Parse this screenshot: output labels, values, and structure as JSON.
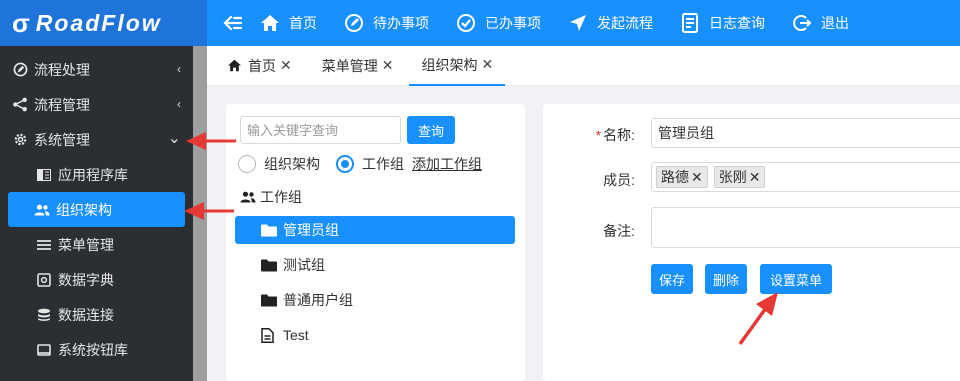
{
  "app": {
    "logo_text": "RoadFlow",
    "logo_mark": "σ"
  },
  "topnav": {
    "toggle_icon": "collapse-arrow-icon",
    "items": [
      {
        "label": "首页",
        "icon": "home-icon"
      },
      {
        "label": "待办事项",
        "icon": "edit-circle-icon"
      },
      {
        "label": "已办事项",
        "icon": "check-circle-icon"
      },
      {
        "label": "发起流程",
        "icon": "send-icon"
      },
      {
        "label": "日志查询",
        "icon": "log-icon"
      },
      {
        "label": "退出",
        "icon": "logout-icon"
      }
    ]
  },
  "sidebar": {
    "groups": [
      {
        "label": "流程处理",
        "icon": "edit-circle-icon",
        "chevron": "‹"
      },
      {
        "label": "流程管理",
        "icon": "share-icon",
        "chevron": "‹"
      },
      {
        "label": "系统管理",
        "icon": "gear-icon",
        "chevron": "⌄"
      }
    ],
    "sub_items": [
      {
        "label": "应用程序库",
        "icon": "library-icon"
      },
      {
        "label": "组织架构",
        "icon": "users-icon"
      },
      {
        "label": "菜单管理",
        "icon": "menu-lines-icon"
      },
      {
        "label": "数据字典",
        "icon": "dictionary-icon"
      },
      {
        "label": "数据连接",
        "icon": "database-icon"
      },
      {
        "label": "系统按钮库",
        "icon": "button-library-icon"
      }
    ]
  },
  "tabs": [
    {
      "label": "首页",
      "close": "✕"
    },
    {
      "label": "菜单管理",
      "close": "✕"
    },
    {
      "label": "组织架构",
      "close": "✕"
    }
  ],
  "left_panel": {
    "search_placeholder": "输入关键字查询",
    "search_button": "查询",
    "radio_org": "组织架构",
    "radio_workgroup": "工作组",
    "selected_radio": "工作组",
    "add_workgroup_link": "添加工作组",
    "tree_root": "工作组",
    "tree_nodes": [
      {
        "label": "管理员组",
        "icon": "folder-icon",
        "selected": true
      },
      {
        "label": "测试组",
        "icon": "folder-icon",
        "selected": false
      },
      {
        "label": "普通用户组",
        "icon": "folder-icon",
        "selected": false
      },
      {
        "label": "Test",
        "icon": "document-icon",
        "selected": false
      }
    ]
  },
  "form": {
    "name_label": "名称:",
    "name_required_mark": "*",
    "name_value": "管理员组",
    "members_label": "成员:",
    "members": [
      "路德",
      "张刚"
    ],
    "tag_remove": "✕",
    "note_label": "备注:",
    "note_value": "",
    "save_button": "保存",
    "delete_button": "删除",
    "set_menu_button": "设置菜单"
  },
  "annotations": {
    "color": "#e53935"
  },
  "colors": {
    "primary": "#1890ff",
    "sidebar_bg": "#2b2f33"
  }
}
